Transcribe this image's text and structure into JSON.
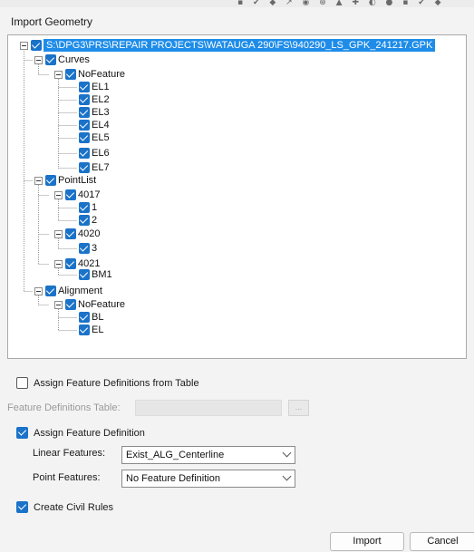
{
  "window": {
    "title": "Import Geometry"
  },
  "tree": {
    "root": "S:\\DPG3\\PRS\\REPAIR PROJECTS\\WATAUGA 290\\FS\\940290_LS_GPK_241217.GPK",
    "curves": "Curves",
    "curves_nofeature": "NoFeature",
    "curve_items": [
      "EL1",
      "EL2",
      "EL3",
      "EL4",
      "EL5",
      "EL6",
      "EL7"
    ],
    "pointlist": "PointList",
    "group_4017": "4017",
    "items_4017": [
      "1",
      "2"
    ],
    "group_4020": "4020",
    "items_4020": [
      "3"
    ],
    "group_4021": "4021",
    "items_4021": [
      "BM1"
    ],
    "alignment": "Alignment",
    "alignment_nofeature": "NoFeature",
    "alignment_items": [
      "BL",
      "EL"
    ]
  },
  "options": {
    "assign_from_table": {
      "label": "Assign Feature Definitions from Table",
      "checked": false
    },
    "feature_table_label": "Feature Definitions Table:",
    "feature_table_value": "",
    "browse_label": "...",
    "assign_feature_def": {
      "label": "Assign Feature Definition",
      "checked": true
    },
    "linear_label": "Linear Features:",
    "linear_value": "Exist_ALG_Centerline",
    "point_label": "Point Features:",
    "point_value": "No Feature Definition",
    "civil_rules": {
      "label": "Create Civil Rules",
      "checked": true
    }
  },
  "buttons": {
    "import": "Import",
    "cancel": "Cancel"
  },
  "colors": {
    "accent": "#1a73c8",
    "selection": "#1e8ce8"
  }
}
